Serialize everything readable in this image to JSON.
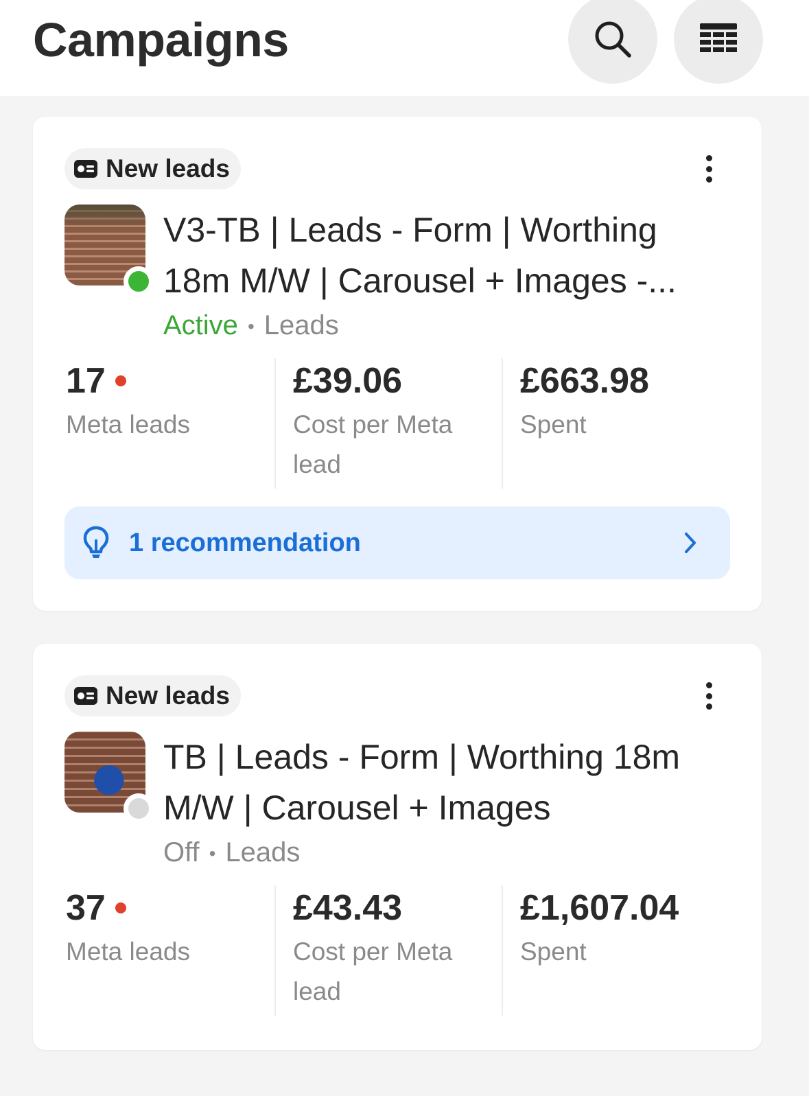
{
  "header": {
    "title": "Campaigns",
    "search_icon": "search-icon",
    "table_icon": "table-columns-icon"
  },
  "campaigns": [
    {
      "badge": "New leads",
      "badge_icon": "lead-form-icon",
      "name": "V3-TB | Leads - Form | Worthing 18m M/W | Carousel + Images -...",
      "status": "Active",
      "status_color": "#3aa735",
      "objective": "Leads",
      "metrics": [
        {
          "value": "17",
          "label": "Meta leads",
          "alert_dot": true
        },
        {
          "value": "£39.06",
          "label": "Cost per Meta lead"
        },
        {
          "value": "£663.98",
          "label": "Spent"
        }
      ],
      "recommendation": {
        "icon": "lightbulb-icon",
        "label": "1 recommendation"
      }
    },
    {
      "badge": "New leads",
      "badge_icon": "lead-form-icon",
      "name": "TB | Leads - Form | Worthing 18m M/W | Carousel + Images",
      "status": "Off",
      "status_color": "#8a8a8a",
      "objective": "Leads",
      "metrics": [
        {
          "value": "37",
          "label": "Meta leads",
          "alert_dot": true
        },
        {
          "value": "£43.43",
          "label": "Cost per Meta lead"
        },
        {
          "value": "£1,607.04",
          "label": "Spent"
        }
      ]
    }
  ],
  "colors": {
    "accent_blue": "#1a6fd6",
    "active_green": "#3cb534",
    "alert_red": "#e1402b",
    "recommendation_bg": "#e4efff"
  }
}
